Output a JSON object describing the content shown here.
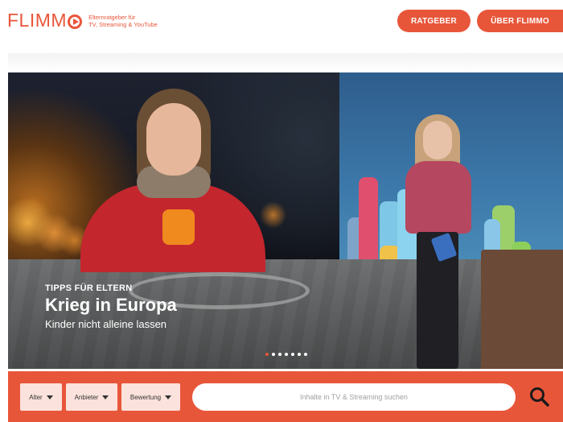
{
  "header": {
    "logo_text": "FLIMM",
    "tagline": [
      "Elternratgeber für",
      "TV, Streaming & YouTube"
    ],
    "nav": {
      "ratgeber": "RATGEBER",
      "ueber": "ÜBER FLIMMO"
    }
  },
  "hero": {
    "kicker": "TIPPS FÜR ELTERN",
    "title": "Krieg in Europa",
    "subtitle": "Kinder nicht alleine lassen",
    "slides_total": 7,
    "active_slide": 1
  },
  "search": {
    "filters": {
      "alter": "Alter",
      "anbieter": "Anbieter",
      "bewertung": "Bewertung"
    },
    "placeholder": "Inhalte in TV & Streaming suchen",
    "button_icon": "search-icon"
  },
  "colors": {
    "accent": "#e8563a",
    "filter_bg": "#fbe2dc"
  }
}
